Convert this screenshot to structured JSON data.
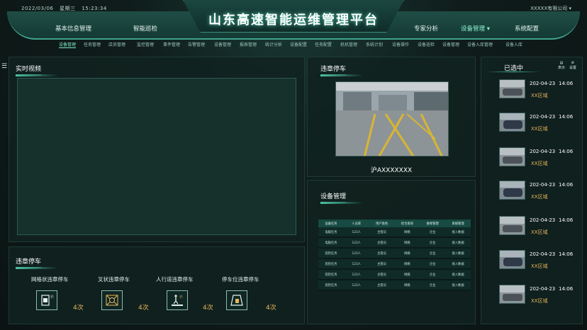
{
  "header": {
    "date": "2022/03/06",
    "weekday": "星期三",
    "time": "15:23:34",
    "title": "山东高速智能运维管理平台",
    "company": "XXXXX有限公司",
    "company_caret": "▾",
    "nav_left": [
      "基本信息管理",
      "智能巡检"
    ],
    "nav_right": [
      "专家分析",
      "设备管理 ▾",
      "系统配置"
    ]
  },
  "subnav": [
    "设备管理",
    "任务管理",
    "店员管理",
    "监控管理",
    "事件管理",
    "告警管理",
    "设备管理",
    "报表管理",
    "统计分析",
    "设备配置",
    "任务配置",
    "机机管理",
    "系统计划",
    "设备操作",
    "设备巡检",
    "设备管理",
    "设备入库管理",
    "设备入库"
  ],
  "menu_icon": "☰",
  "video_panel": {
    "title": "实时视频"
  },
  "violation_panel": {
    "title": "违章停车",
    "items": [
      {
        "label": "网格状违章停车",
        "count": "4次",
        "icon": "grid-parking-icon"
      },
      {
        "label": "叉状违章停车",
        "count": "4次",
        "icon": "cross-parking-icon"
      },
      {
        "label": "人行道违章停车",
        "count": "4次",
        "icon": "sidewalk-parking-icon"
      },
      {
        "label": "停车位违章停车",
        "count": "4次",
        "icon": "parking-spot-icon"
      }
    ]
  },
  "photo_panel": {
    "title": "违章停车",
    "plate": "沪AXXXXXXX"
  },
  "device_panel": {
    "title": "设备管理",
    "columns": [
      "设备任务",
      "人员库",
      "用户角色",
      "综合查询",
      "维修管理",
      "系统管理"
    ],
    "rows": [
      [
        "电脑任务",
        "123人",
        "主管员",
        "网络",
        "企业",
        "接入数据"
      ],
      [
        "电脑任务",
        "123人",
        "主管员",
        "网络",
        "企业",
        "接入数据"
      ],
      [
        "巡检任务",
        "123人",
        "主管员",
        "网络",
        "企业",
        "接入数据"
      ],
      [
        "巡检任务",
        "123人",
        "主管员",
        "网络",
        "企业",
        "接入数据"
      ],
      [
        "巡检任务",
        "123人",
        "主管员",
        "网络",
        "企业",
        "接入数据"
      ],
      [
        "巡检任务",
        "123人",
        "主管员",
        "网络",
        "企业",
        "接入数据"
      ]
    ]
  },
  "selected_panel": {
    "title": "已选中",
    "tools": [
      {
        "icon": "▤",
        "label": "表示"
      },
      {
        "icon": "⚙",
        "label": "设置"
      }
    ],
    "items": [
      {
        "date": "202-04-23",
        "time": "14:06",
        "area": "XX区域"
      },
      {
        "date": "202-04-23",
        "time": "14:06",
        "area": "XX区域"
      },
      {
        "date": "202-04-23",
        "time": "14:06",
        "area": "XX区域"
      },
      {
        "date": "202-04-23",
        "time": "14:06",
        "area": "XX区域"
      },
      {
        "date": "202-04-23",
        "time": "14:06",
        "area": "XX区域"
      },
      {
        "date": "202-04-23",
        "time": "14:06",
        "area": "XX区域"
      },
      {
        "date": "202-04-23",
        "time": "14:06",
        "area": "XX区域"
      }
    ]
  }
}
